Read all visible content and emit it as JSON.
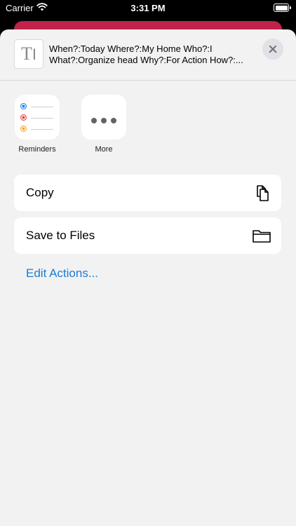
{
  "status_bar": {
    "carrier": "Carrier",
    "time": "3:31 PM"
  },
  "share_sheet": {
    "preview_text": "When?:Today Where?:My Home Who?:I What?:Organize head Why?:For Action How?:...",
    "apps": [
      {
        "label": "Reminders",
        "icon": "reminders-icon"
      },
      {
        "label": "More",
        "icon": "more-icon"
      }
    ],
    "actions": [
      {
        "label": "Copy",
        "icon": "copy-icon"
      },
      {
        "label": "Save to Files",
        "icon": "folder-icon"
      }
    ],
    "edit_actions_label": "Edit Actions..."
  },
  "colors": {
    "background_card": "#c0224a",
    "sheet": "#f2f2f2",
    "link": "#1a7bd4",
    "reminder_dots": [
      "#1b7ee3",
      "#e5403a",
      "#f5a623"
    ]
  }
}
